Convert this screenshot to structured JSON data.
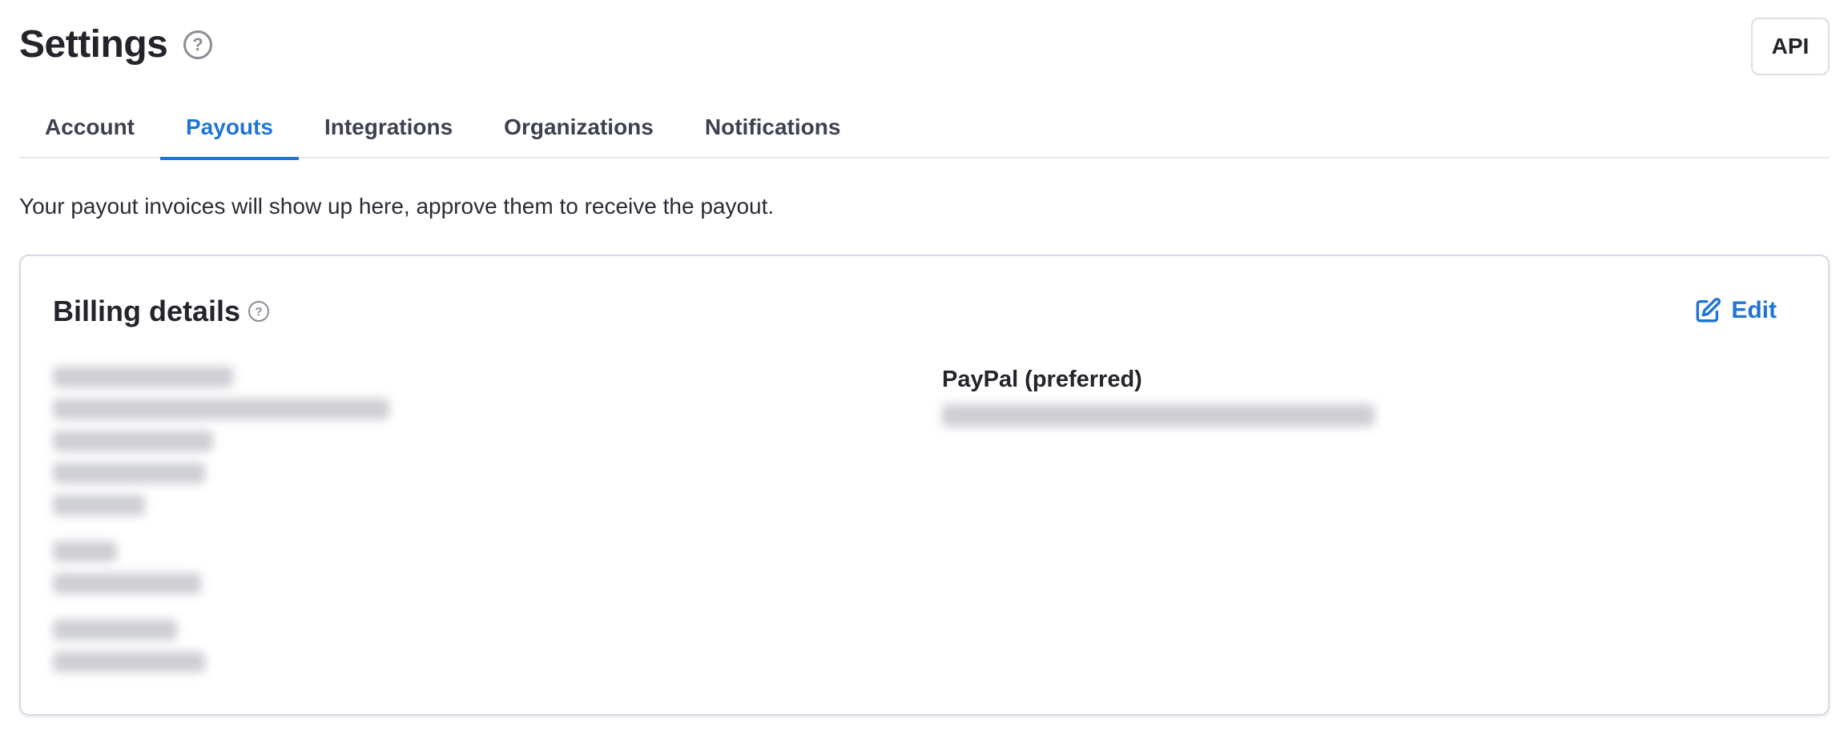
{
  "header": {
    "title": "Settings",
    "help_icon": "question-circle-icon",
    "api_button_label": "API"
  },
  "tabs": [
    {
      "label": "Account",
      "active": false
    },
    {
      "label": "Payouts",
      "active": true
    },
    {
      "label": "Integrations",
      "active": false
    },
    {
      "label": "Organizations",
      "active": false
    },
    {
      "label": "Notifications",
      "active": false
    }
  ],
  "description": "Your payout invoices will show up here, approve them to receive the payout.",
  "billing": {
    "title": "Billing details",
    "help_icon": "question-circle-icon",
    "edit_label": "Edit",
    "edit_icon": "edit-icon",
    "paypal_label": "PayPal (preferred)"
  },
  "colors": {
    "accent": "#1f75d4",
    "text": "#23242c",
    "border": "#d7d9e6"
  }
}
